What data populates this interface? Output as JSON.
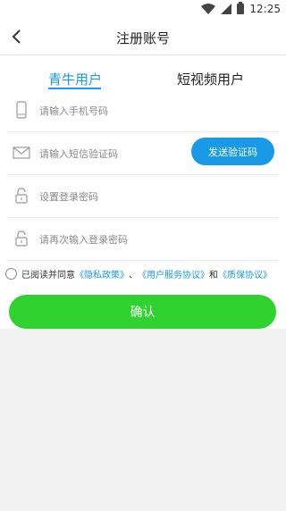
{
  "status_bar": {
    "time": "12:25",
    "icons": [
      "wifi-icon",
      "signal-icon",
      "battery-icon"
    ]
  },
  "header": {
    "title": "注册账号",
    "back_icon": "back-chevron-icon"
  },
  "tabs": [
    {
      "label": "青牛用户",
      "active": true
    },
    {
      "label": "短视频用户",
      "active": false
    }
  ],
  "form": {
    "phone": {
      "placeholder": "请输入手机号码",
      "icon": "phone-icon"
    },
    "sms_code": {
      "placeholder": "请输入短信验证码",
      "icon": "envelope-icon",
      "send_button_label": "发送验证码"
    },
    "password": {
      "placeholder": "设置登录密码",
      "icon": "lock-icon"
    },
    "password_confirm": {
      "placeholder": "请再次输入登录密码",
      "icon": "lock-icon"
    }
  },
  "agreement": {
    "prefix": "已阅读并同意",
    "privacy_link": "《隐私政策》",
    "sep1": "、",
    "service_link": "《用户服务协议》",
    "and": "和",
    "warranty_link": "《质保协议》"
  },
  "confirm_label": "确认",
  "colors": {
    "accent": "#1a9ae6",
    "confirm": "#2fd22f",
    "background": "#f2f2f2"
  }
}
